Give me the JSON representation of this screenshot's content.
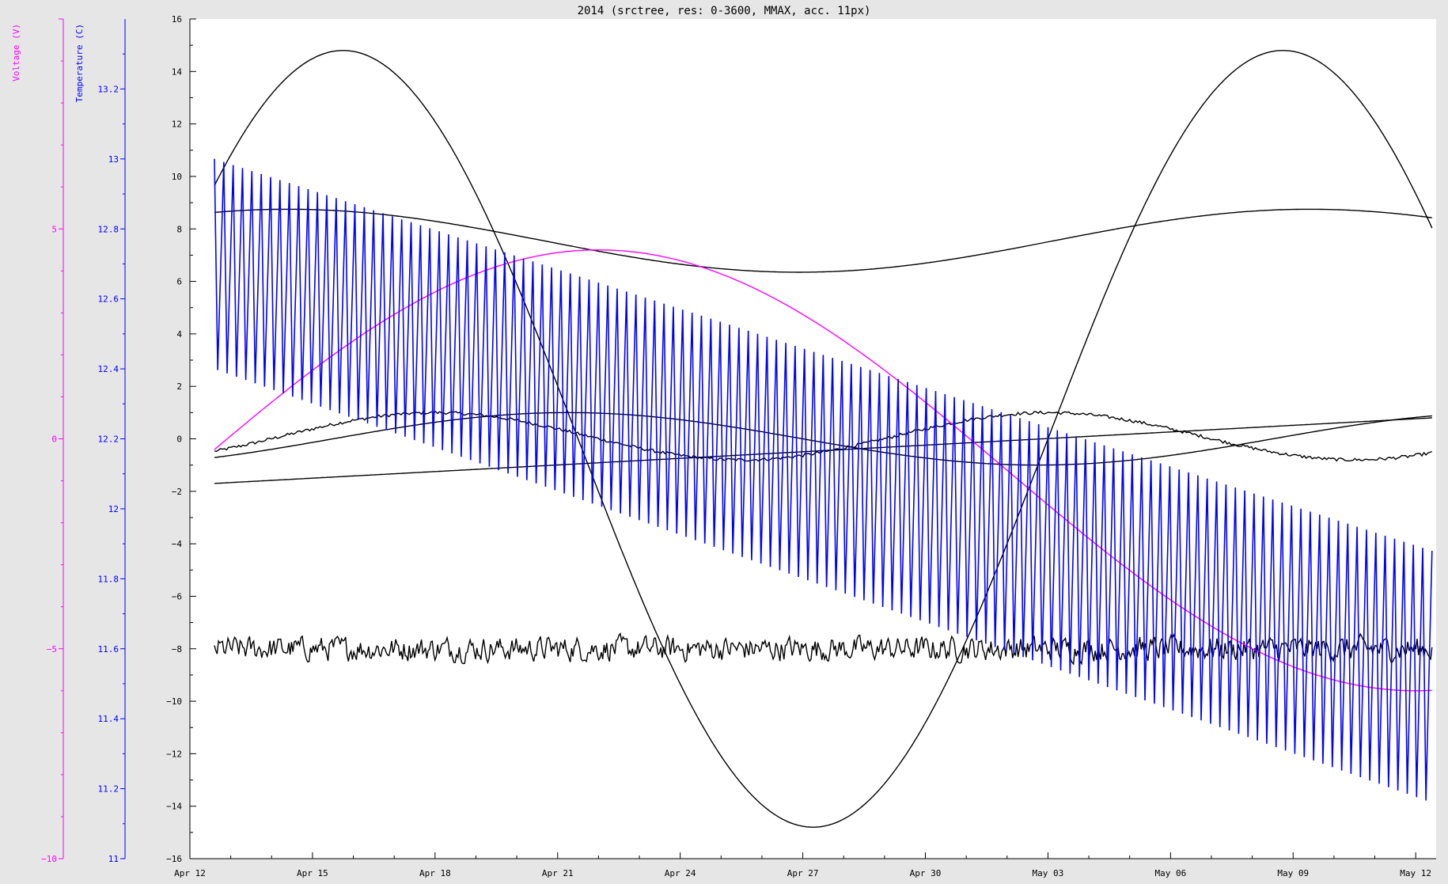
{
  "chart_data": {
    "type": "line",
    "title": "2014 (srctree, res: 0-3600, MMAX, acc. 11px)",
    "x_ticks": [
      "Apr 12",
      "Apr 15",
      "Apr 18",
      "Apr 21",
      "Apr 24",
      "Apr 27",
      "Apr 30",
      "May 03",
      "May 06",
      "May 09",
      "May 12"
    ],
    "x_range_days": [
      0,
      30.5
    ],
    "data_range_days": [
      0.6,
      30.4
    ],
    "axes": {
      "main": {
        "range": [
          -16,
          16
        ],
        "ticks": [
          "16",
          "14",
          "12",
          "10",
          "8",
          "6",
          "4",
          "2",
          "0",
          "−2",
          "−4",
          "−6",
          "−8",
          "−10",
          "−12",
          "−14",
          "−16"
        ]
      },
      "temperature": {
        "label": "Temperature (C)",
        "color": "#0000ff",
        "range": [
          11.0,
          13.4
        ],
        "ticks": [
          "13.2",
          "13",
          "12.8",
          "12.6",
          "12.4",
          "12.2",
          "12",
          "11.8",
          "11.6",
          "11.4",
          "11.2",
          "11"
        ]
      },
      "voltage": {
        "label": "Voltage (V)",
        "color": "#ff00ff",
        "range": [
          -10,
          10
        ],
        "ticks": [
          "5",
          "0",
          "−5",
          "−10"
        ]
      }
    },
    "series": [
      {
        "axis": "main",
        "color": "#000000",
        "kind": "sine",
        "amplitude": 14.8,
        "period_days": 23,
        "peak_day": 3.75,
        "offset": 0
      },
      {
        "axis": "main",
        "color": "#000000",
        "kind": "sine",
        "amplitude": 0.9,
        "period_days": 15,
        "peak_day": 6.0,
        "offset": 0.1,
        "noise": 0.12
      },
      {
        "axis": "main",
        "color": "#000000",
        "kind": "sine",
        "amplitude": 1.0,
        "period_days": 23,
        "peak_day": 9.25,
        "offset": 0
      },
      {
        "axis": "main",
        "color": "#000000",
        "kind": "linear",
        "start": -1.7,
        "end": 0.8
      },
      {
        "axis": "main",
        "color": "#000000",
        "kind": "wave",
        "base": 7.55,
        "amplitude": 1.2,
        "period_days": 25,
        "peak_day": 27.4,
        "trend": 0
      },
      {
        "axis": "main",
        "color": "#000000",
        "kind": "noise",
        "base": -8.0,
        "spread": 0.4
      },
      {
        "axis": "voltage",
        "color": "#ff00ff",
        "kind": "sine",
        "amplitude": 5.25,
        "period_days": 40,
        "peak_day": 10.0,
        "offset": -0.75
      },
      {
        "axis": "temperature",
        "color": "#0000ff",
        "kind": "sawtooth",
        "top_start": 13.0,
        "top_end": 11.88,
        "bottom_start": 12.4,
        "bottom_end": 11.16,
        "cycles": 130
      }
    ]
  }
}
